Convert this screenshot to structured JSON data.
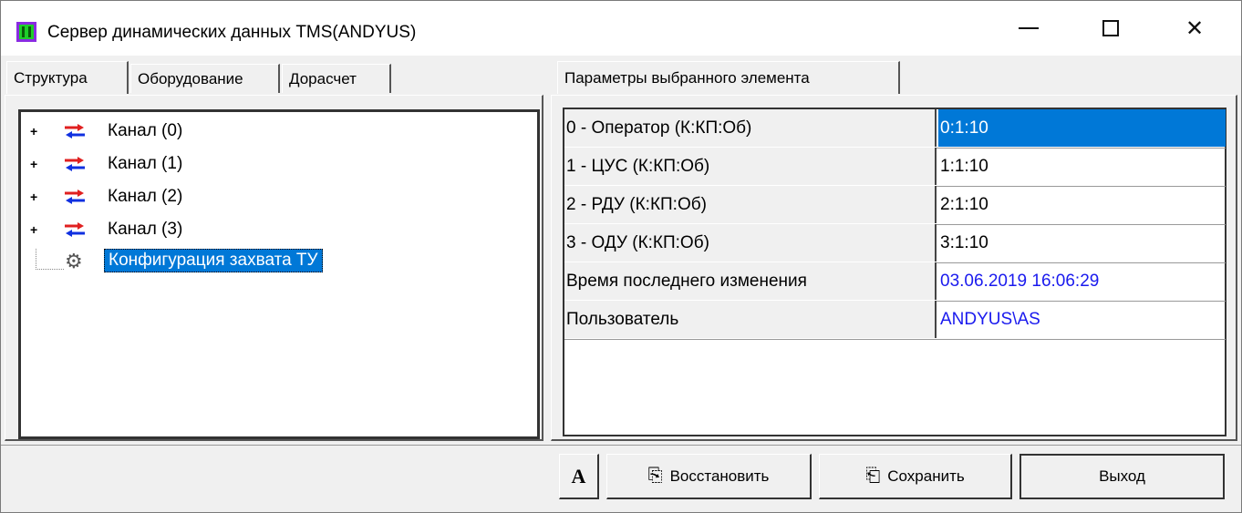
{
  "window": {
    "title": "Сервер динамических данных TMS(ANDYUS)"
  },
  "left_tabs": [
    "Структура",
    "Оборудование",
    "Дорасчет"
  ],
  "tree": {
    "items": [
      {
        "label": "Канал  (0)",
        "expand": "+"
      },
      {
        "label": "Канал  (1)",
        "expand": "+"
      },
      {
        "label": "Канал  (2)",
        "expand": "+"
      },
      {
        "label": "Канал  (3)",
        "expand": "+"
      },
      {
        "label": "Конфигурация захвата ТУ"
      }
    ]
  },
  "right_tab": "Параметры выбранного элемента",
  "params": [
    {
      "name": "0 - Оператор (К:КП:Об)",
      "value": "0:1:10"
    },
    {
      "name": "1 - ЦУС (К:КП:Об)",
      "value": "1:1:10"
    },
    {
      "name": "2 - РДУ (К:КП:Об)",
      "value": "2:1:10"
    },
    {
      "name": "3 - ОДУ (К:КП:Об)",
      "value": "3:1:10"
    },
    {
      "name": "Время последнего изменения",
      "value": "03.06.2019 16:06:29"
    },
    {
      "name": "Пользователь",
      "value": "ANDYUS\\AS"
    }
  ],
  "buttons": {
    "font": "A",
    "restore": "Восстановить",
    "save": "Сохранить",
    "exit": "Выход"
  },
  "colors": {
    "selection": "#0078d7",
    "link_value": "#1a1aee"
  }
}
